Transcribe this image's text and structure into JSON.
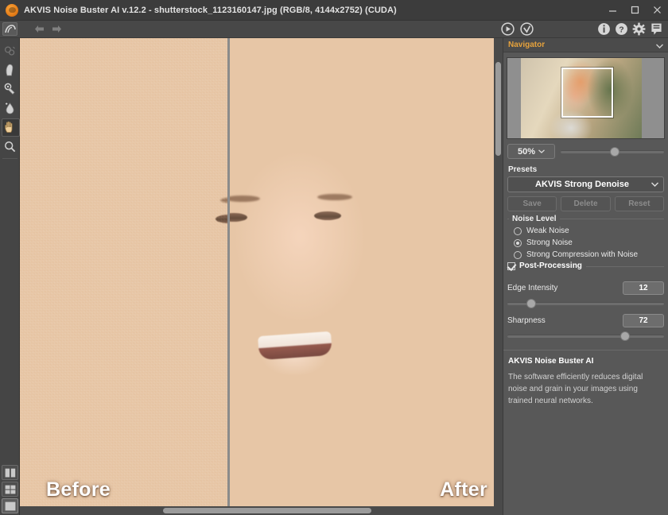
{
  "window": {
    "title": "AKVIS Noise Buster AI v.12.2 - shutterstock_1123160147.jpg (RGB/8, 4144x2752) (CUDA)",
    "logo_icon": "akvis-logo-icon",
    "minimize_icon": "minimize-icon",
    "maximize_icon": "maximize-icon",
    "close_icon": "close-icon"
  },
  "toolbar": {
    "home_icon": "akvis-home-icon",
    "back_icon": "back-arrow-icon",
    "forward_icon": "forward-arrow-icon",
    "run_icon": "run-play-icon",
    "apply_icon": "apply-check-icon",
    "about_icon": "info-icon",
    "help_icon": "help-question-icon",
    "preferences_icon": "gear-icon",
    "print_icon": "print-icon"
  },
  "tools": [
    {
      "name": "quick-selection-tool",
      "icon": "quick-selection-icon",
      "enabled": false,
      "active": false
    },
    {
      "name": "smudge-tool",
      "icon": "smudge-brush-icon",
      "enabled": true,
      "active": false
    },
    {
      "name": "history-brush-tool",
      "icon": "history-brush-icon",
      "enabled": true,
      "active": false
    },
    {
      "name": "blur-tool",
      "icon": "blur-drop-icon",
      "enabled": true,
      "active": false
    },
    {
      "name": "hand-tool",
      "icon": "hand-icon",
      "enabled": true,
      "active": true
    },
    {
      "name": "zoom-tool",
      "icon": "magnifier-icon",
      "enabled": true,
      "active": false
    }
  ],
  "view_buttons": [
    {
      "name": "view-split-vertical",
      "icon": "split-view-icon",
      "selected": false
    },
    {
      "name": "view-split-compare",
      "icon": "compare-view-icon",
      "selected": false
    },
    {
      "name": "view-single",
      "icon": "single-view-icon",
      "selected": true
    }
  ],
  "canvas": {
    "before_label": "Before",
    "after_label": "After"
  },
  "navigator": {
    "title": "Navigator",
    "collapse_icon": "chevron-down-icon",
    "zoom_value": "50%",
    "zoom_dropdown_icon": "chevron-down-icon",
    "zoom_slider_percent": 50
  },
  "presets": {
    "title": "Presets",
    "selected": "AKVIS Strong Denoise",
    "dropdown_icon": "chevron-down-icon",
    "buttons": [
      {
        "label": "Save",
        "name": "save-preset-button"
      },
      {
        "label": "Delete",
        "name": "delete-preset-button"
      },
      {
        "label": "Reset",
        "name": "reset-preset-button"
      }
    ]
  },
  "noise_level": {
    "title": "Noise Level",
    "options": [
      {
        "label": "Weak Noise",
        "selected": false
      },
      {
        "label": "Strong Noise",
        "selected": true
      },
      {
        "label": "Strong Compression with Noise",
        "selected": false
      }
    ]
  },
  "post_processing": {
    "label": "Post-Processing",
    "checked": true,
    "params": [
      {
        "label": "Edge Intensity",
        "value": "12",
        "percent": 12
      },
      {
        "label": "Sharpness",
        "value": "72",
        "percent": 72
      }
    ]
  },
  "info": {
    "title": "AKVIS Noise Buster AI",
    "body": "The software efficiently reduces digital noise and grain in your images using trained neural networks."
  }
}
